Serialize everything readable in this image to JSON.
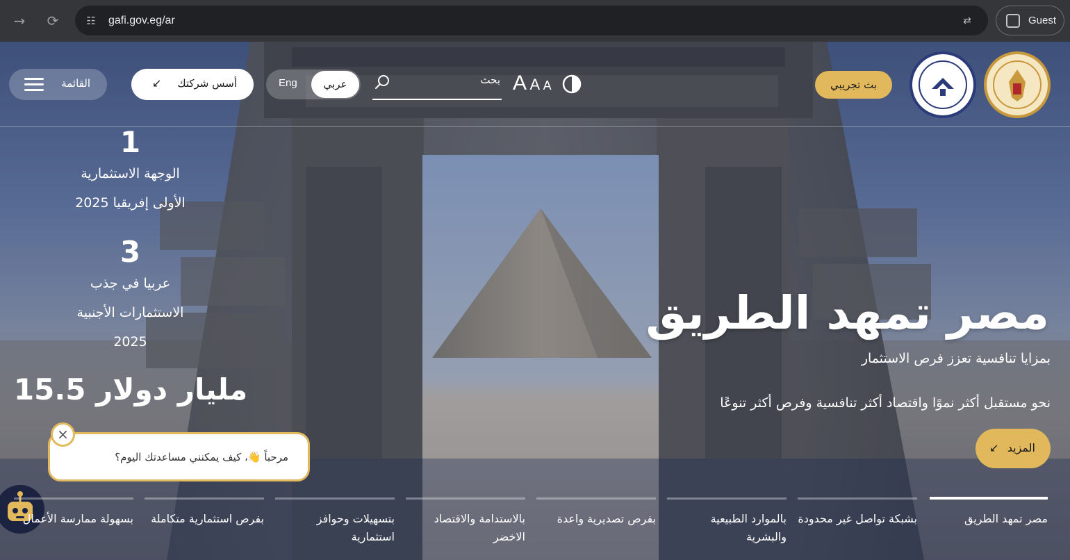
{
  "browser": {
    "url": "gafi.gov.eg/ar",
    "profile_label": "Guest",
    "icons": [
      "arrow-forward-icon",
      "reload-icon",
      "site-settings-icon",
      "translate-icon",
      "profile-icon"
    ]
  },
  "header": {
    "menu_label": "القائمة",
    "found_company_label": "أسس شركتك",
    "lang_en": "Eng",
    "lang_ar": "عربي",
    "search_label": "بحث",
    "font_size_large": "A",
    "font_size_medium": "A",
    "font_size_small": "A",
    "live_label": "بث تجريبي"
  },
  "stats": [
    {
      "number": "1",
      "line1": "الوجهة الاستثمارية",
      "line2": "الأولى إفريقيا 2025"
    },
    {
      "number": "3",
      "line1": "عربيا في جذب",
      "line2": "الاستثمارات الأجنبية",
      "line3": "2025"
    },
    {
      "number": "15.5 مليار دولار"
    }
  ],
  "hero": {
    "title": "مصر تمهد الطريق",
    "subtitle": "بمزايا تنافسية تعزز فرص الاستثمار",
    "description": "نحو مستقبل أكثر نموًا واقتصاد أكثر تنافسية وفرص أكثر تنوعًا",
    "more_label": "المزيد"
  },
  "chat": {
    "message": "مرحباً 👋، كيف يمكنني مساعدتك اليوم؟",
    "close_symbol": "×"
  },
  "tabs": [
    {
      "label": "مصر تمهد الطريق",
      "active": true
    },
    {
      "label": "بشبكة تواصل غير محدودة",
      "active": false
    },
    {
      "label": "بالموارد الطبيعية والبشرية",
      "active": false
    },
    {
      "label": "بفرص تصديرية واعدة",
      "active": false
    },
    {
      "label": "بالاستدامة والاقتصاد الاخضر",
      "active": false
    },
    {
      "label": "بتسهيلات وحوافز استثمارية",
      "active": false
    },
    {
      "label": "بفرص استثمارية متكاملة",
      "active": false
    },
    {
      "label": "بسهولة ممارسة الأعمال",
      "active": false
    }
  ],
  "colors": {
    "accent_gold": "#e2b85c",
    "chrome_dark": "#35363a",
    "omnibox": "#202124"
  }
}
